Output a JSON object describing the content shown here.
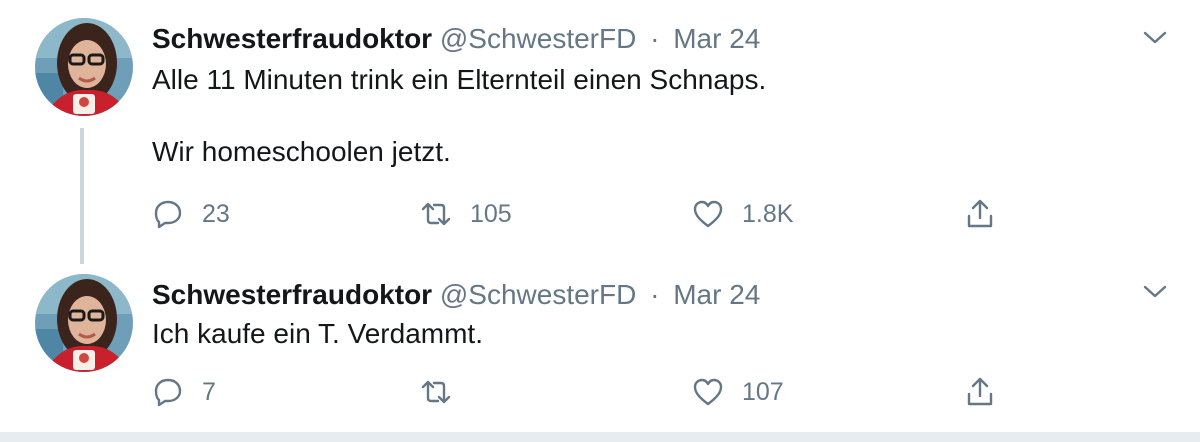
{
  "tweets": [
    {
      "author_name": "Schwesterfraudoktor",
      "handle": "@SchwesterFD",
      "separator": "·",
      "date": "Mar 24",
      "text": "Alle 11 Minuten trink ein Elternteil einen Schnaps.\n\nWir homeschoolen jetzt.",
      "replies": "23",
      "retweets": "105",
      "likes": "1.8K"
    },
    {
      "author_name": "Schwesterfraudoktor",
      "handle": "@SchwesterFD",
      "separator": "·",
      "date": "Mar 24",
      "text": "Ich kaufe ein T. Verdammt.",
      "replies": "7",
      "retweets": "",
      "likes": "107"
    }
  ],
  "icons": {
    "reply": "reply-icon",
    "retweet": "retweet-icon",
    "like": "heart-icon",
    "share": "share-icon",
    "more": "chevron-down-icon"
  },
  "colors": {
    "secondary_text": "#657786",
    "thread_line": "#ccd6dd",
    "background": "#ffffff"
  }
}
